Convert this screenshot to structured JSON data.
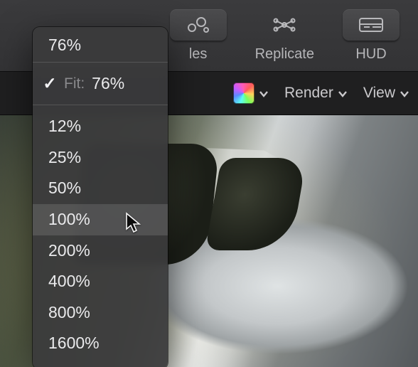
{
  "topbar": {
    "tools": {
      "particles": {
        "label": "les"
      },
      "replicate": {
        "label": "Replicate"
      },
      "hud": {
        "label": "HUD"
      }
    }
  },
  "subbar": {
    "fit_label": "Fit:",
    "render_label": "Render",
    "view_label": "View"
  },
  "zoom": {
    "current": "76%",
    "fit_checked": "✓",
    "fit_value": "76%",
    "levels": [
      "12%",
      "25%",
      "50%",
      "100%",
      "200%",
      "400%",
      "800%",
      "1600%"
    ],
    "hover_index": 3
  }
}
